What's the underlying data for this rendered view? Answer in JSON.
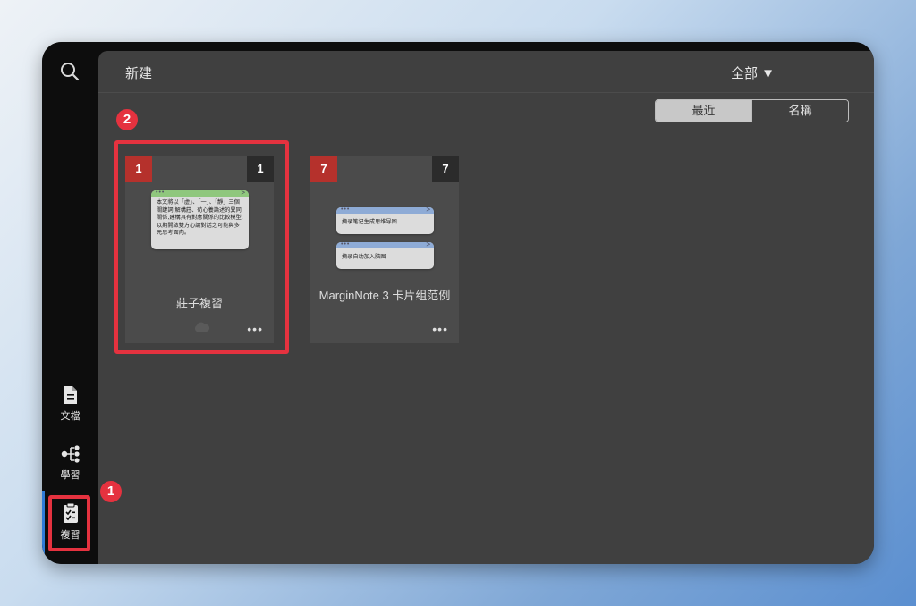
{
  "sidebar": {
    "items": [
      {
        "label": "文檔",
        "icon": "document-icon"
      },
      {
        "label": "學習",
        "icon": "mindmap-icon"
      },
      {
        "label": "複習",
        "icon": "clipboard-check-icon"
      }
    ]
  },
  "topbar": {
    "new_label": "新建",
    "filter_label": "全部 ▼"
  },
  "sort": {
    "recent_label": "最近",
    "name_label": "名稱",
    "selected": "最近"
  },
  "cards": [
    {
      "title": "莊子複習",
      "badge_left": "1",
      "badge_right": "1",
      "note_text": "本文將以「虛」、「一」、「靜」三個關鍵詞,解構莊、荀心養論述的異同關係,建構具有對應關係的比較模型,以期開啟雙方心論對話之可能與多元思考面向。"
    },
    {
      "title": "MarginNote 3 卡片组范例",
      "badge_left": "7",
      "badge_right": "7",
      "note1_text": "摘录笔记生成思维导图",
      "note2_text": "摘录自动加入脑图"
    }
  ],
  "annotations": {
    "step1": "1",
    "step2": "2"
  },
  "colors": {
    "highlight": "#e5323f",
    "badge_red": "#b5312c",
    "accent_blue": "#2f7bd8"
  }
}
